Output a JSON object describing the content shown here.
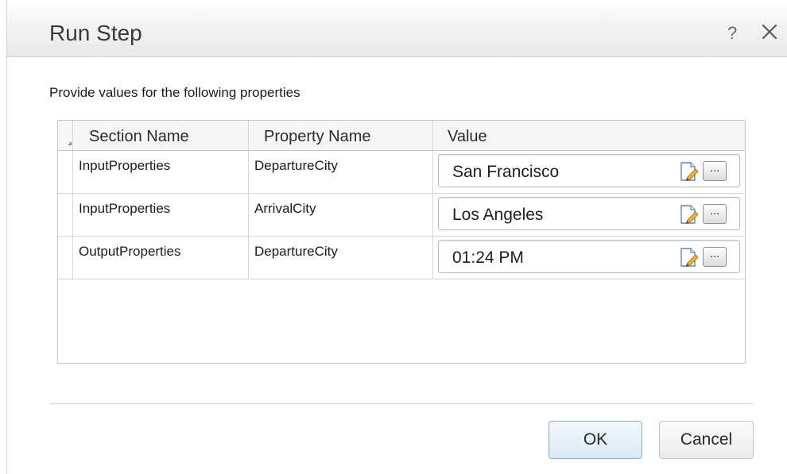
{
  "dialog": {
    "title": "Run Step",
    "help_label": "?",
    "instruction": "Provide values for the following properties"
  },
  "table": {
    "columns": [
      "Section Name",
      "Property Name",
      "Value"
    ],
    "rows": [
      {
        "section": "InputProperties",
        "property": "DepartureCity",
        "value": "San Francisco",
        "more_label": "..."
      },
      {
        "section": "InputProperties",
        "property": "ArrivalCity",
        "value": "Los Angeles",
        "more_label": "..."
      },
      {
        "section": "OutputProperties",
        "property": "DepartureCity",
        "value": "01:24 PM",
        "more_label": "..."
      }
    ]
  },
  "buttons": {
    "ok_label": "OK",
    "cancel_label": "Cancel"
  },
  "colors": {
    "ok_border": "#7fb2d9",
    "ok_fill": "#d9e9f6"
  },
  "icons": {
    "help": "question-mark",
    "close": "x-mark",
    "edit": "edit-document-pencil",
    "more": "ellipsis-button"
  }
}
